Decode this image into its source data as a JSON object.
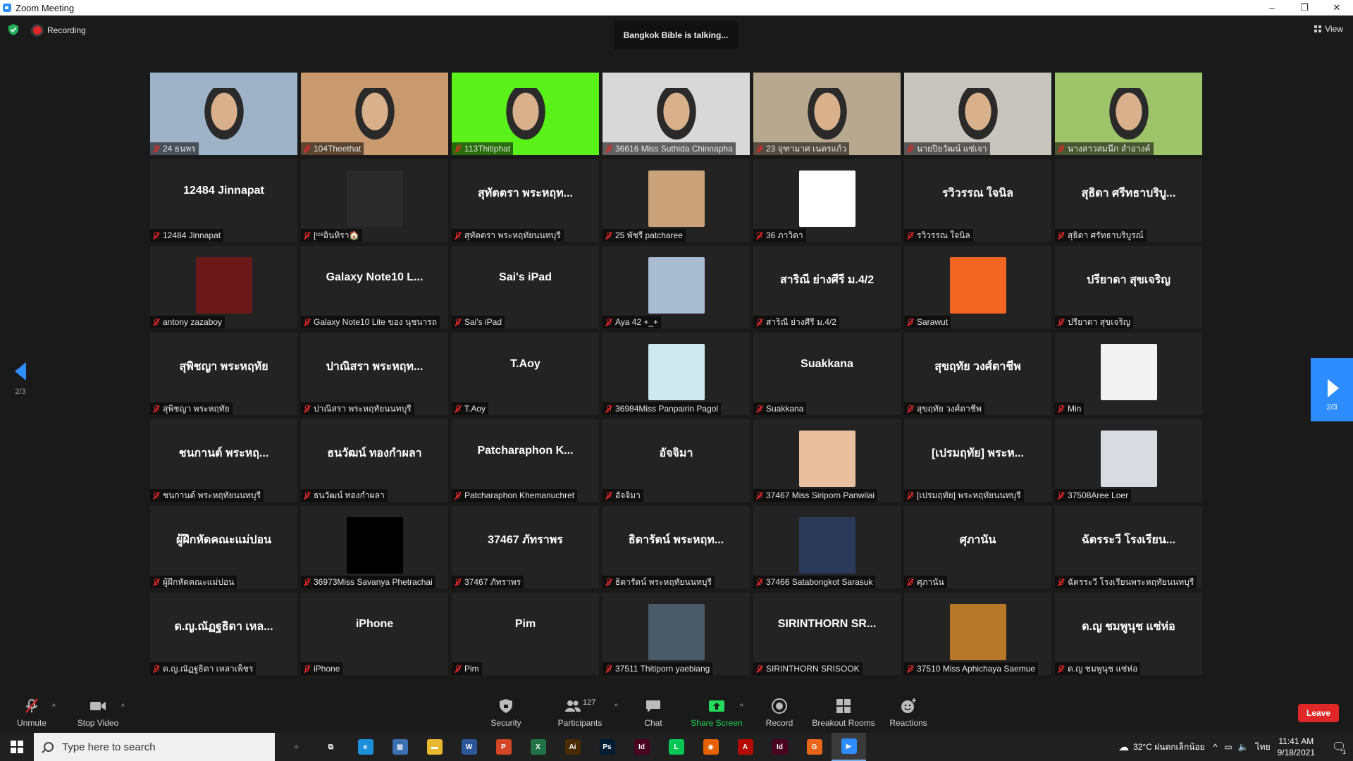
{
  "window": {
    "title": "Zoom Meeting",
    "min": "–",
    "max": "❐",
    "close": "✕"
  },
  "meeting": {
    "recording_label": "Recording",
    "talking": "Bangkok Bible is talking...",
    "view_label": "View",
    "page_indicator": "2/3"
  },
  "participants": [
    {
      "kind": "video",
      "bg": "#9fb3c8",
      "name": "24 ธนพร"
    },
    {
      "kind": "video",
      "bg": "#c89a6e",
      "name": "104Theethat"
    },
    {
      "kind": "video",
      "bg": "#5af21a",
      "name": "113Thitiphat"
    },
    {
      "kind": "video",
      "bg": "#d8d8d8",
      "name": "36616 Miss Suthida Chinnapha"
    },
    {
      "kind": "video",
      "bg": "#b8a890",
      "name": "23 จุฑามาศ เนตรแก้ว"
    },
    {
      "kind": "video",
      "bg": "#c8c4be",
      "name": "นายปิยวัฒน์ แซ่เจา"
    },
    {
      "kind": "video",
      "bg": "#9ec46a",
      "name": "นางสาวสมนึก ลำอางค์"
    },
    {
      "kind": "text",
      "display": "12484 Jinnapat",
      "name": "12484 Jinnapat"
    },
    {
      "kind": "avatar",
      "bg": "#2a2a2a",
      "name": "[ᶦᶜᵉอินทิรา🏠"
    },
    {
      "kind": "text",
      "display": "สุทัตตรา พระหฤท...",
      "name": "สุทัตตรา พระหฤทัยนนทบุรี"
    },
    {
      "kind": "avatar",
      "bg": "#caa27a",
      "name": "25 พัชรี patcharee"
    },
    {
      "kind": "avatar",
      "bg": "#ffffff",
      "name": "36 ภาวิดา"
    },
    {
      "kind": "text",
      "display": "รวิวรรณ ใจนิล",
      "name": "รวิวรรณ ใจนิล"
    },
    {
      "kind": "text",
      "display": "สุธิดา ศรีทธาบริบู...",
      "name": "สุธิดา ศรัทธาบริบูรณ์"
    },
    {
      "kind": "avatar",
      "bg": "#6a1818",
      "name": "antony zazaboy"
    },
    {
      "kind": "text",
      "display": "Galaxy Note10 L...",
      "name": "Galaxy Note10 Lite ของ นุชนารถ"
    },
    {
      "kind": "text",
      "display": "Sai's iPad",
      "name": "Sai's iPad"
    },
    {
      "kind": "avatar",
      "bg": "#a9bcd2",
      "name": "Aya 42 +_+"
    },
    {
      "kind": "text",
      "display": "สาริณี ย่างศีรี ม.4/2",
      "name": "สาริณี ย่างศีรี ม.4/2"
    },
    {
      "kind": "avatar",
      "bg": "#f26422",
      "name": "Sarawut"
    },
    {
      "kind": "text",
      "display": "ปรียาดา สุขเจริญ",
      "name": "ปรียาดา สุขเจริญ"
    },
    {
      "kind": "text",
      "display": "สุพิชญา พระหฤทัย",
      "name": "สุพิชญา พระหฤทัย"
    },
    {
      "kind": "text",
      "display": "ปาณิสรา พระหฤท...",
      "name": "ปาณิสรา พระหฤทัยนนทบุรี"
    },
    {
      "kind": "text",
      "display": "T.Aoy",
      "name": "T.Aoy"
    },
    {
      "kind": "avatar",
      "bg": "#cfe8ee",
      "name": "36984Miss Panpairin Pagol"
    },
    {
      "kind": "text",
      "display": "Suakkana",
      "name": "Suakkana"
    },
    {
      "kind": "text",
      "display": "สุขฤทัย วงศ์ตาชีพ",
      "name": "สุขฤทัย วงศ์ตาชีพ"
    },
    {
      "kind": "avatar",
      "bg": "#f2f2f2",
      "name": "Min"
    },
    {
      "kind": "text",
      "display": "ชนกานต์ พระหฤ...",
      "name": "ชนกานต์ พระหฤทัยนนทบุรี"
    },
    {
      "kind": "text",
      "display": "ธนวัฒน์ ทองกำผลา",
      "name": "ธนวัฒน์ ทองกำผลา"
    },
    {
      "kind": "text",
      "display": "Patcharaphon K...",
      "name": "Patcharaphon Khemanuchret"
    },
    {
      "kind": "text",
      "display": "อัจจิมา",
      "name": "อัจจิมา"
    },
    {
      "kind": "avatar",
      "bg": "#e8c0a0",
      "name": "37467 Miss Siriporn Panwilai"
    },
    {
      "kind": "text",
      "display": "[เปรมฤทัย] พระห...",
      "name": "[เปรมฤทัย] พระหฤทัยนนทบุรี"
    },
    {
      "kind": "avatar",
      "bg": "#d8dce0",
      "name": "37508Aree Loer"
    },
    {
      "kind": "text",
      "display": "ผู้ฝึกหัดคณะแม่ปอน",
      "name": "ผู้ฝึกหัดคณะแม่ปอน"
    },
    {
      "kind": "avatar",
      "bg": "#000000",
      "name": "36973Miss Savanya Phetrachai"
    },
    {
      "kind": "text",
      "display": "37467 ภัทราพร",
      "name": "37467 ภัทราพร"
    },
    {
      "kind": "text",
      "display": "ธิดารัตน์ พระหฤท...",
      "name": "ธิดารัตน์ พระหฤทัยนนทบุรี"
    },
    {
      "kind": "avatar",
      "bg": "#2c3a5a",
      "name": "37466 Satabongkot Sarasuk"
    },
    {
      "kind": "text",
      "display": "ศุภานัน",
      "name": "ศุภานัน"
    },
    {
      "kind": "text",
      "display": "ฉัตรระวี โรงเรียน...",
      "name": "ฉัตรระวี โรงเรียนพระหฤทัยนนทบุรี"
    },
    {
      "kind": "text",
      "display": "ด.ญ.ณัฏฐธิดา เหล...",
      "name": "ด.ญ.ณัฏฐธิดา เหลาเพ็ชร"
    },
    {
      "kind": "text",
      "display": "iPhone",
      "name": "iPhone"
    },
    {
      "kind": "text",
      "display": "Pim",
      "name": "Pim"
    },
    {
      "kind": "avatar",
      "bg": "#4a5a66",
      "name": "37511 Thitiporn yaebiang"
    },
    {
      "kind": "text",
      "display": "SIRINTHORN SR...",
      "name": "SIRINTHORN SRISOOK"
    },
    {
      "kind": "avatar",
      "bg": "#b8782a",
      "name": "37510 Miss Aphichaya Saemue"
    },
    {
      "kind": "text",
      "display": "ด.ญ ชมพูนุช แซ่ห่อ",
      "name": "ด.ญ ชมพูนุช แซ่ห่อ"
    }
  ],
  "toolbar": {
    "unmute": "Unmute",
    "stop_video": "Stop Video",
    "security": "Security",
    "participants": "Participants",
    "participants_count": "127",
    "chat": "Chat",
    "share_screen": "Share Screen",
    "record": "Record",
    "breakout_rooms": "Breakout Rooms",
    "reactions": "Reactions",
    "leave": "Leave",
    "share_color": "#23d959"
  },
  "taskbar": {
    "search_placeholder": "Type here to search",
    "weather": "32°C ฝนตกเล็กน้อย",
    "lang": "ไทย",
    "time": "11:41 AM",
    "date": "9/18/2021",
    "notif": "1",
    "apps": [
      {
        "icon": "cortana-icon",
        "label": "○",
        "color": "transparent"
      },
      {
        "icon": "task-view-icon",
        "label": "⧉",
        "color": "transparent"
      },
      {
        "icon": "edge-icon",
        "label": "e",
        "color": "#1b8fd8"
      },
      {
        "icon": "calculator-icon",
        "label": "▦",
        "color": "#3a6fb0"
      },
      {
        "icon": "file-explorer-icon",
        "label": "▬",
        "color": "#e8b830"
      },
      {
        "icon": "word-icon",
        "label": "W",
        "color": "#2b579a"
      },
      {
        "icon": "powerpoint-icon",
        "label": "P",
        "color": "#d24726"
      },
      {
        "icon": "excel-icon",
        "label": "X",
        "color": "#217346"
      },
      {
        "icon": "illustrator-icon",
        "label": "Ai",
        "color": "#4a2a00"
      },
      {
        "icon": "photoshop-icon",
        "label": "Ps",
        "color": "#001d34"
      },
      {
        "icon": "indesign-icon",
        "label": "Id",
        "color": "#49021f"
      },
      {
        "icon": "line-icon",
        "label": "L",
        "color": "#06c755"
      },
      {
        "icon": "firefox-icon",
        "label": "◉",
        "color": "#e66000"
      },
      {
        "icon": "acrobat-icon",
        "label": "A",
        "color": "#b30b00"
      },
      {
        "icon": "indesign-alt-icon",
        "label": "Id",
        "color": "#49021f"
      },
      {
        "icon": "grammarly-icon",
        "label": "G",
        "color": "#e8651a"
      },
      {
        "icon": "zoom-icon",
        "label": "▶",
        "color": "#2d8cff"
      }
    ]
  }
}
